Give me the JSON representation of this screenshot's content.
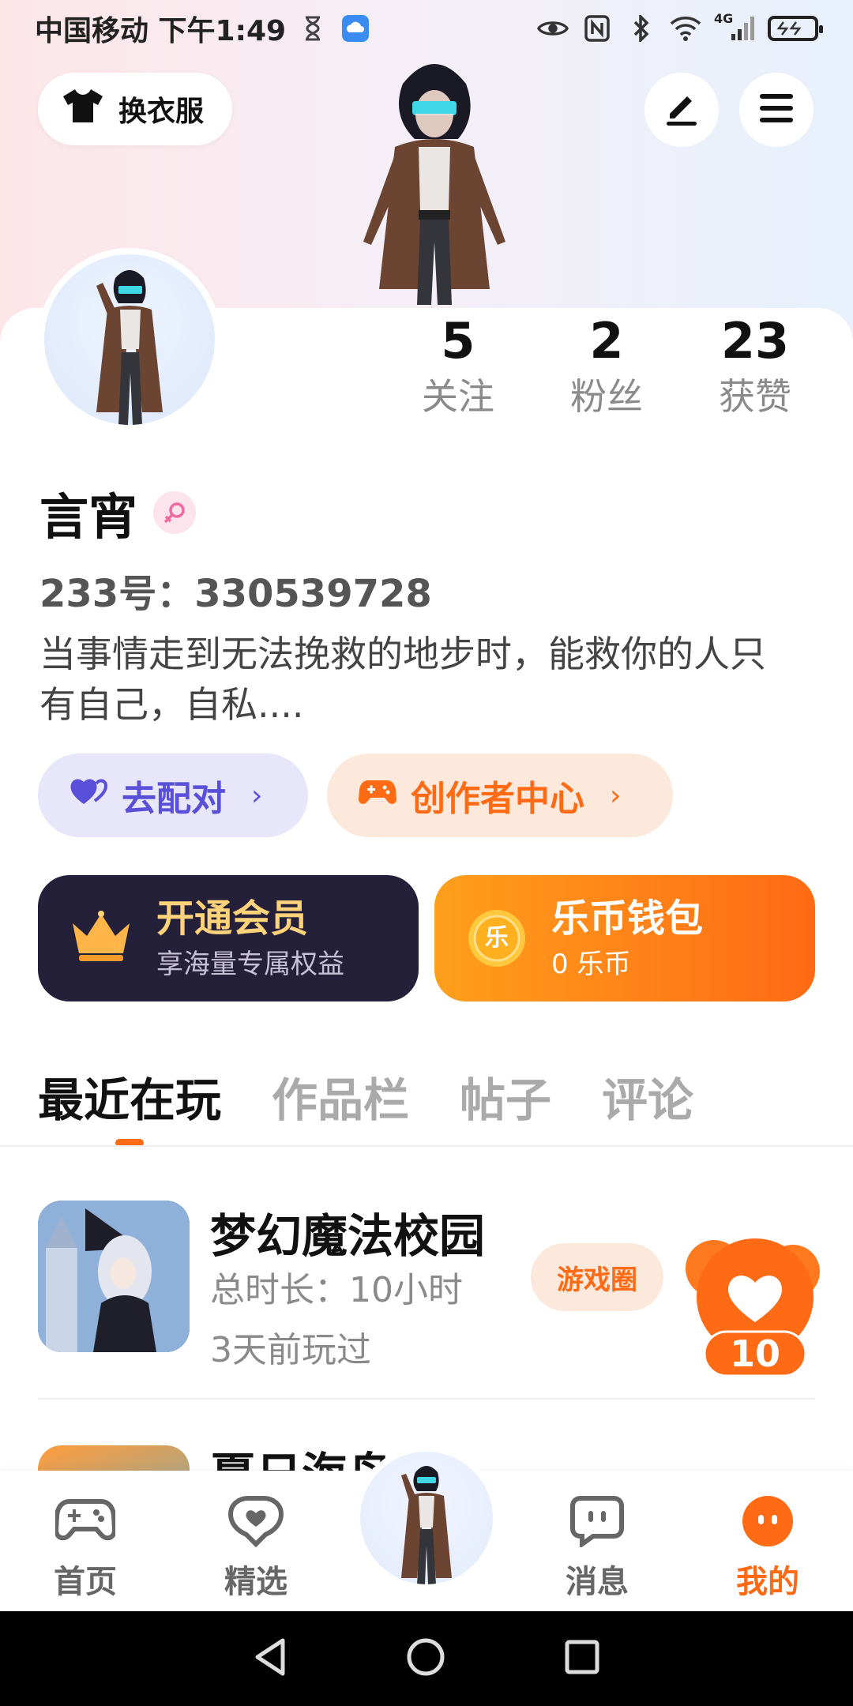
{
  "status_bar": {
    "carrier_time": "中国移动 下午1:49",
    "network_label": "4G"
  },
  "header": {
    "outfit_label": "换衣服"
  },
  "profile": {
    "stats": [
      {
        "value": "5",
        "label": "关注"
      },
      {
        "value": "2",
        "label": "粉丝"
      },
      {
        "value": "23",
        "label": "获赞"
      }
    ],
    "username": "言宵",
    "user_id": "233号：330539728",
    "bio": "当事情走到无法挽救的地步时，能救你的人只有自己，自私...."
  },
  "actions": {
    "match_label": "去配对",
    "creator_label": "创作者中心"
  },
  "promos": {
    "vip_title": "开通会员",
    "vip_sub": "享海量专属权益",
    "wallet_title": "乐币钱包",
    "wallet_sub": "0 乐币",
    "coin_glyph": "乐"
  },
  "tabs": [
    {
      "label": "最近在玩",
      "active": true
    },
    {
      "label": "作品栏",
      "active": false
    },
    {
      "label": "帖子",
      "active": false
    },
    {
      "label": "评论",
      "active": false
    }
  ],
  "games": [
    {
      "title": "梦幻魔法校园",
      "total_time": "总时长：10小时",
      "last_played": "3天前玩过",
      "circle_label": "游戏圈",
      "likes": "10"
    },
    {
      "title": "夏日海岛"
    }
  ],
  "bottom_nav": [
    {
      "label": "首页",
      "icon": "gamepad-icon"
    },
    {
      "label": "精选",
      "icon": "heart-chat-icon"
    },
    {
      "label": "消息",
      "icon": "chat-bubble-icon"
    },
    {
      "label": "我的",
      "icon": "face-icon",
      "active": true
    }
  ],
  "colors": {
    "accent": "#ff6a14",
    "match_purple": "#5a4fd8",
    "vip_dark": "#24203a",
    "vip_gold": "#ffd37a"
  }
}
